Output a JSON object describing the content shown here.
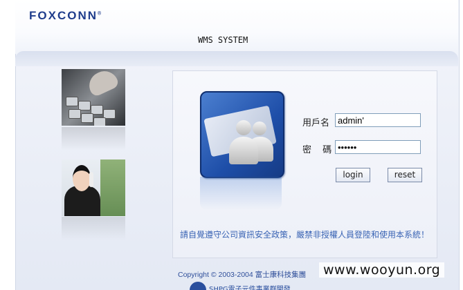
{
  "header": {
    "logo_text": "FOXCONN",
    "logo_mark": "®",
    "system_title": "WMS SYSTEM"
  },
  "login_form": {
    "username_label": "用戶名",
    "username_value": "admin'",
    "password_label": "密 碼",
    "password_value": "••••••",
    "login_button": "login",
    "reset_button": "reset"
  },
  "notice": "請自覺遵守公司資訊安全政策，嚴禁非授權人員登陸和使用本系統！",
  "footer": {
    "copyright": "Copyright © 2003-2004 富士康科技集團",
    "division": "SHPG電子元件事業群開發"
  },
  "icons": [
    "users-icon",
    "keyboard-photo",
    "operator-photo"
  ],
  "colors": {
    "brand": "#1f3d8c",
    "notice": "#3a64b4",
    "panel_bg": "#edf0f8"
  },
  "watermark": "www.wooyun.org"
}
